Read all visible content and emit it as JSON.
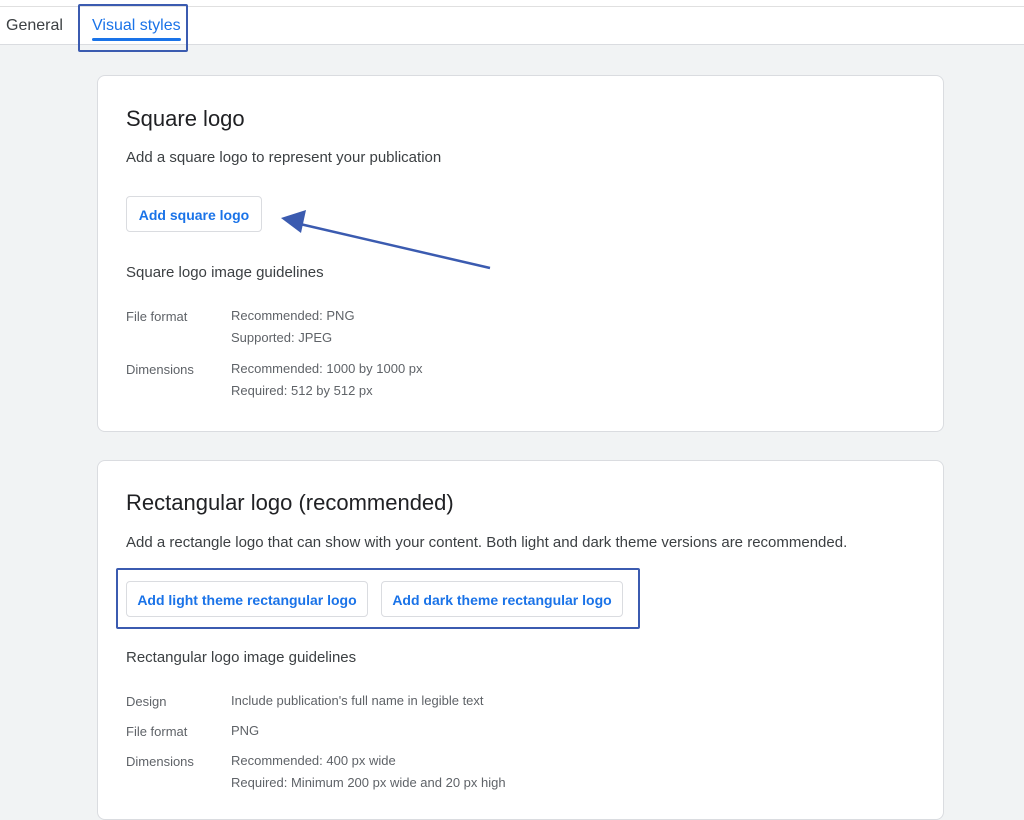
{
  "tabs": {
    "general": "General",
    "visual_styles": "Visual styles",
    "active": "visual_styles"
  },
  "square_logo": {
    "title": "Square logo",
    "description": "Add a square logo to represent your publication",
    "add_button": "Add square logo",
    "guidelines_title": "Square logo image guidelines",
    "guidelines": [
      {
        "label": "File format",
        "values": [
          "Recommended: PNG",
          "Supported: JPEG"
        ]
      },
      {
        "label": "Dimensions",
        "values": [
          "Recommended: 1000 by 1000 px",
          "Required: 512 by 512 px"
        ]
      }
    ]
  },
  "rectangular_logo": {
    "title": "Rectangular logo (recommended)",
    "description": "Add a rectangle logo that can show with your content. Both light and dark theme versions are recommended.",
    "add_light_button": "Add light theme rectangular logo",
    "add_dark_button": "Add dark theme rectangular logo",
    "guidelines_title": "Rectangular logo image guidelines",
    "guidelines": [
      {
        "label": "Design",
        "values": [
          "Include publication's full name in legible text"
        ]
      },
      {
        "label": "File format",
        "values": [
          "PNG"
        ]
      },
      {
        "label": "Dimensions",
        "values": [
          "Recommended: 400 px wide",
          "Required: Minimum 200 px wide and 20 px high"
        ]
      }
    ]
  },
  "colors": {
    "accent": "#1a73e8",
    "annotation": "#3b5bb0",
    "page_background": "#f1f3f4"
  }
}
